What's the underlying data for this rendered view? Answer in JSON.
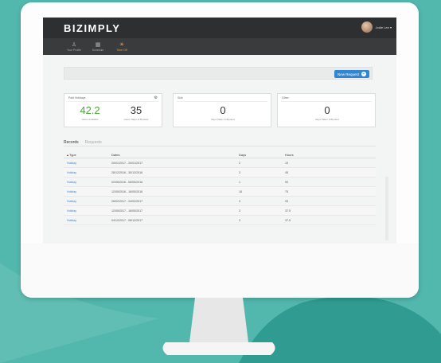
{
  "colors": {
    "background": "#4fb6ac",
    "accent": "#e8a23a",
    "link": "#2f86d6",
    "success": "#4aa63a",
    "topbar": "#2e2f30"
  },
  "header": {
    "brand": "BIZIMPLY",
    "user_name": "Jodie Lee ▾"
  },
  "nav": [
    {
      "label": "Your Profile",
      "icon": "person-icon"
    },
    {
      "label": "Schedule",
      "icon": "calendar-icon"
    },
    {
      "label": "Time Off",
      "icon": "time-off-icon",
      "active": true
    }
  ],
  "requests": {
    "new_label": "New Request",
    "icon": "plus-icon"
  },
  "cards": [
    {
      "title": "Paid Holidays",
      "icon": "gear-icon",
      "values": [
        "42.2",
        "35"
      ],
      "subs": [
        "Hours Available",
        "Hours Taken & Booked"
      ]
    },
    {
      "title": "Sick",
      "values": [
        "0"
      ],
      "subs": [
        "Days Taken & Booked"
      ]
    },
    {
      "title": "Other",
      "values": [
        "0"
      ],
      "subs": [
        "Days Taken & Booked"
      ]
    }
  ],
  "tabs": [
    "Records",
    "Requests"
  ],
  "table": {
    "headers": [
      "▴ Type",
      "Dates",
      "Days",
      "Hours"
    ],
    "rows": [
      [
        "Holiday",
        "20/01/2017 - 20/01/2017",
        "2",
        "15"
      ],
      [
        "Holiday",
        "28/12/2016 - 30/12/2016",
        "3",
        "45"
      ],
      [
        "Holiday",
        "02/05/2016 - 06/05/2016",
        "1",
        "90"
      ],
      [
        "Holiday",
        "12/05/2016 - 16/05/2016",
        "18",
        "75"
      ],
      [
        "Holiday",
        "26/02/2017 - 24/02/2017",
        "3",
        "25"
      ],
      [
        "Holiday",
        "12/05/2017 - 16/05/2017",
        "3",
        "37.5"
      ],
      [
        "Holiday",
        "04/12/2017 - 08/12/2017",
        "3",
        "37.5"
      ]
    ]
  }
}
